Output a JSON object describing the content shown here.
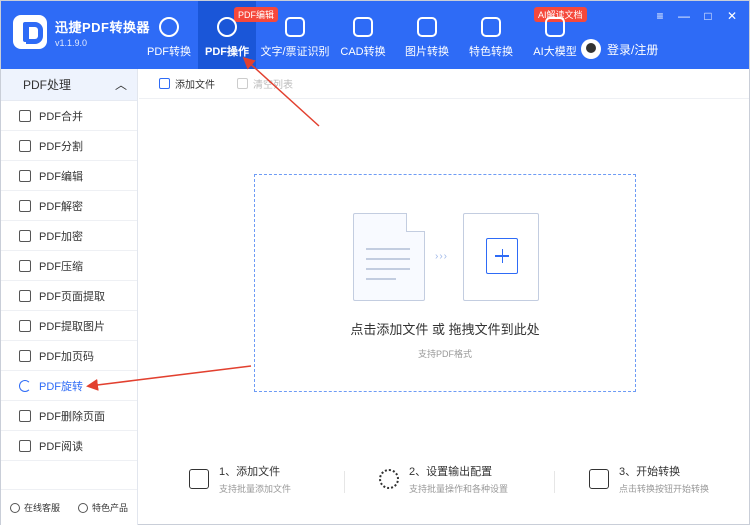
{
  "app": {
    "title": "迅捷PDF转换器",
    "version": "v1.1.9.0"
  },
  "nav": [
    {
      "label": "PDF转换",
      "badge": ""
    },
    {
      "label": "PDF操作",
      "badge": "PDF编辑",
      "active": true
    },
    {
      "label": "文字/票证识别",
      "badge": ""
    },
    {
      "label": "CAD转换",
      "badge": ""
    },
    {
      "label": "图片转换",
      "badge": ""
    },
    {
      "label": "特色转换",
      "badge": ""
    },
    {
      "label": "AI大模型",
      "badge": "AI解读文档"
    }
  ],
  "user": {
    "login_label": "登录/注册"
  },
  "window_controls": {
    "menu": "≡",
    "minimize": "—",
    "maximize": "□",
    "close": "✕"
  },
  "sidebar": {
    "header": "PDF处理",
    "items": [
      {
        "label": "PDF合并"
      },
      {
        "label": "PDF分割"
      },
      {
        "label": "PDF编辑"
      },
      {
        "label": "PDF解密"
      },
      {
        "label": "PDF加密"
      },
      {
        "label": "PDF压缩"
      },
      {
        "label": "PDF页面提取"
      },
      {
        "label": "PDF提取图片"
      },
      {
        "label": "PDF加页码"
      },
      {
        "label": "PDF旋转",
        "active": true
      },
      {
        "label": "PDF删除页面"
      },
      {
        "label": "PDF阅读"
      }
    ],
    "footer": {
      "service": "在线客服",
      "featured": "特色产品"
    }
  },
  "toolbar": {
    "add_file": "添加文件",
    "clear_list": "清空列表"
  },
  "dropzone": {
    "main_text": "点击添加文件 或 拖拽文件到此处",
    "sub_text": "支持PDF格式",
    "arrows": "›››"
  },
  "steps": [
    {
      "title": "1、添加文件",
      "desc": "支持批量添加文件"
    },
    {
      "title": "2、设置输出配置",
      "desc": "支持批量操作和各种设置"
    },
    {
      "title": "3、开始转换",
      "desc": "点击转换按钮开始转换"
    }
  ],
  "colors": {
    "primary": "#2e6bf6",
    "active_nav": "#1a56d8",
    "badge": "#f5483b",
    "annotation": "#e2402f"
  }
}
